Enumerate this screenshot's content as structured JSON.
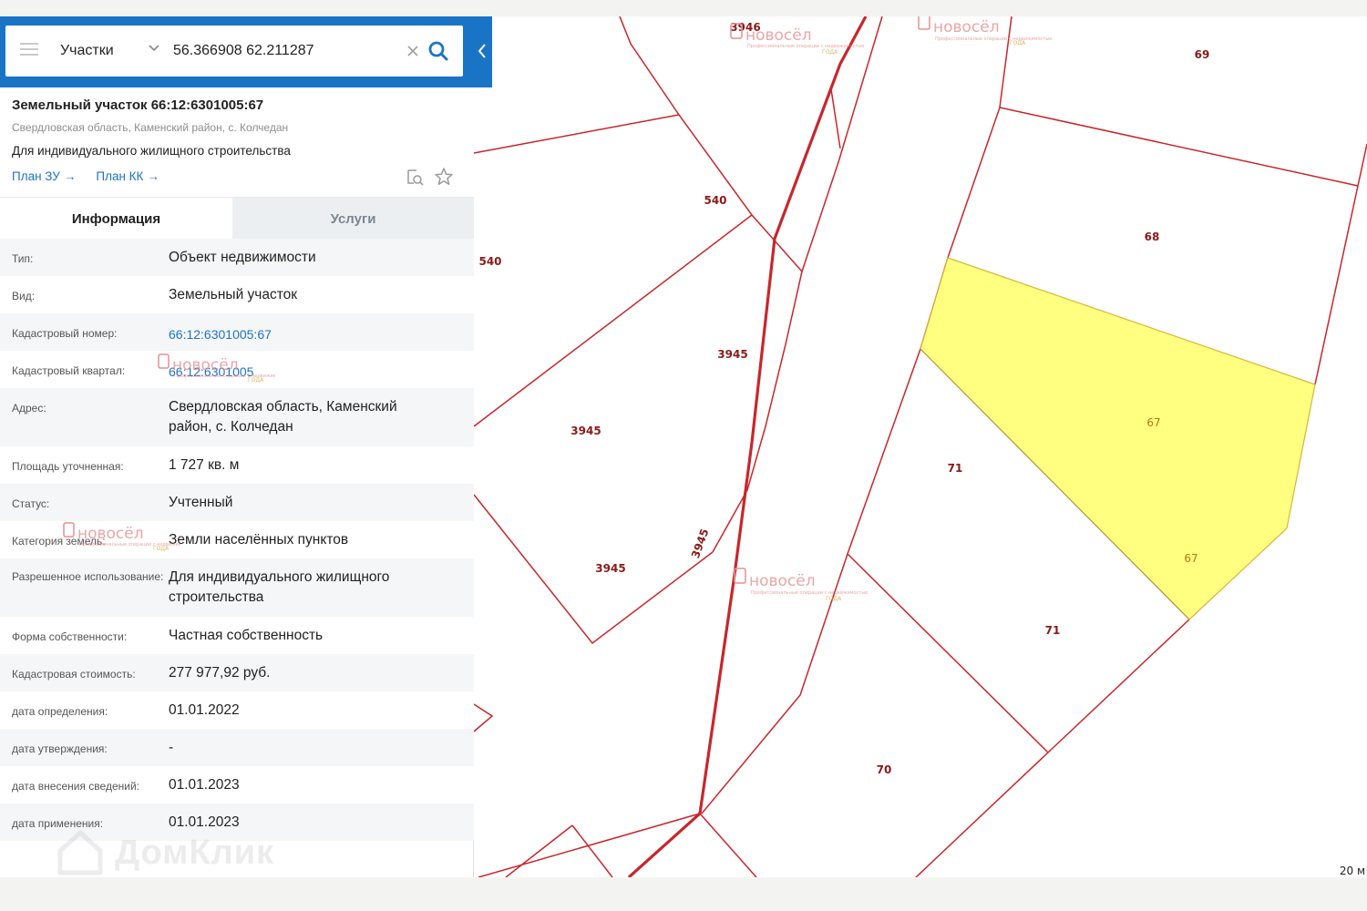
{
  "search": {
    "layer": "Участки",
    "query": "56.366908 62.211287",
    "menu_icon": "hamburger-icon",
    "clear_icon": "close-icon",
    "search_icon": "search-icon",
    "collapse_icon": "chevron-left-icon"
  },
  "parcel": {
    "title": "Земельный участок 66:12:6301005:67",
    "address": "Свердловская область, Каменский район, с. Колчедан",
    "use": "Для индивидуального жилищного строительства",
    "links": [
      "План ЗУ",
      "План КК"
    ]
  },
  "tabs": [
    {
      "label": "Информация",
      "active": true
    },
    {
      "label": "Услуги",
      "active": false
    }
  ],
  "info": [
    {
      "key": "Тип:",
      "value": "Объект недвижимости"
    },
    {
      "key": "Вид:",
      "value": "Земельный участок"
    },
    {
      "key": "Кадастровый номер:",
      "value": "66:12:6301005:67",
      "link": true
    },
    {
      "key": "Кадастровый квартал:",
      "value": "66:12:6301005",
      "link": true
    },
    {
      "key": "Адрес:",
      "value": "Свердловская область, Каменский район, с. Колчедан"
    },
    {
      "key": "Площадь уточненная:",
      "value": "1 727 кв. м"
    },
    {
      "key": "Статус:",
      "value": "Учтенный"
    },
    {
      "key": "Категория земель:",
      "value": "Земли населённых пунктов"
    },
    {
      "key": "Разрешенное использование:",
      "value": "Для индивидуального жилищного строительства"
    },
    {
      "key": "Форма собственности:",
      "value": "Частная собственность"
    },
    {
      "key": "Кадастровая стоимость:",
      "value": "277 977,92 руб."
    },
    {
      "key": "дата определения:",
      "value": "01.01.2022"
    },
    {
      "key": "дата утверждения:",
      "value": "-"
    },
    {
      "key": "дата внесения сведений:",
      "value": "01.01.2023"
    },
    {
      "key": "дата применения:",
      "value": "01.01.2023"
    }
  ],
  "map": {
    "labels": [
      "3946",
      "69",
      "540",
      "540",
      "68",
      "3945",
      "3945",
      "67",
      "71",
      "67",
      "3945",
      "3945",
      "71",
      "70"
    ],
    "scale": "20 м",
    "colors": {
      "boundary": "#c8262b",
      "selected_fill": "#ffff80",
      "selected_stroke": "#d9b43a",
      "panel_header": "#1a74c6"
    }
  },
  "watermarks": {
    "brand": "новосёл",
    "sub": "Профессиональные операции с недвижимостью",
    "year": "ГОДА",
    "domclick": "ДомКлик"
  }
}
